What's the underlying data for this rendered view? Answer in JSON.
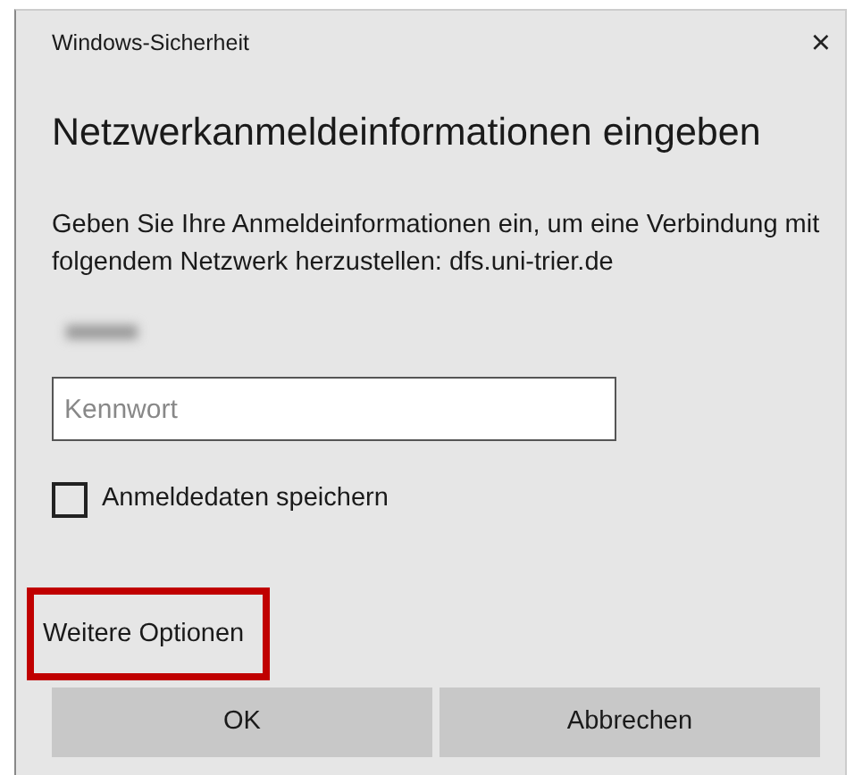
{
  "window": {
    "title": "Windows-Sicherheit",
    "close": "×"
  },
  "heading": "Netzwerkanmeldeinformationen eingeben",
  "message": "Geben Sie Ihre Anmeldeinformationen ein, um eine Verbindung mit folgendem Netzwerk herzustellen: dfs.uni-trier.de",
  "password": {
    "placeholder": "Kennwort"
  },
  "remember": {
    "label": "Anmeldedaten speichern",
    "checked": false
  },
  "more_options": {
    "label": "Weitere Optionen",
    "highlighted": true
  },
  "buttons": [
    "OK",
    "Abbrechen"
  ]
}
